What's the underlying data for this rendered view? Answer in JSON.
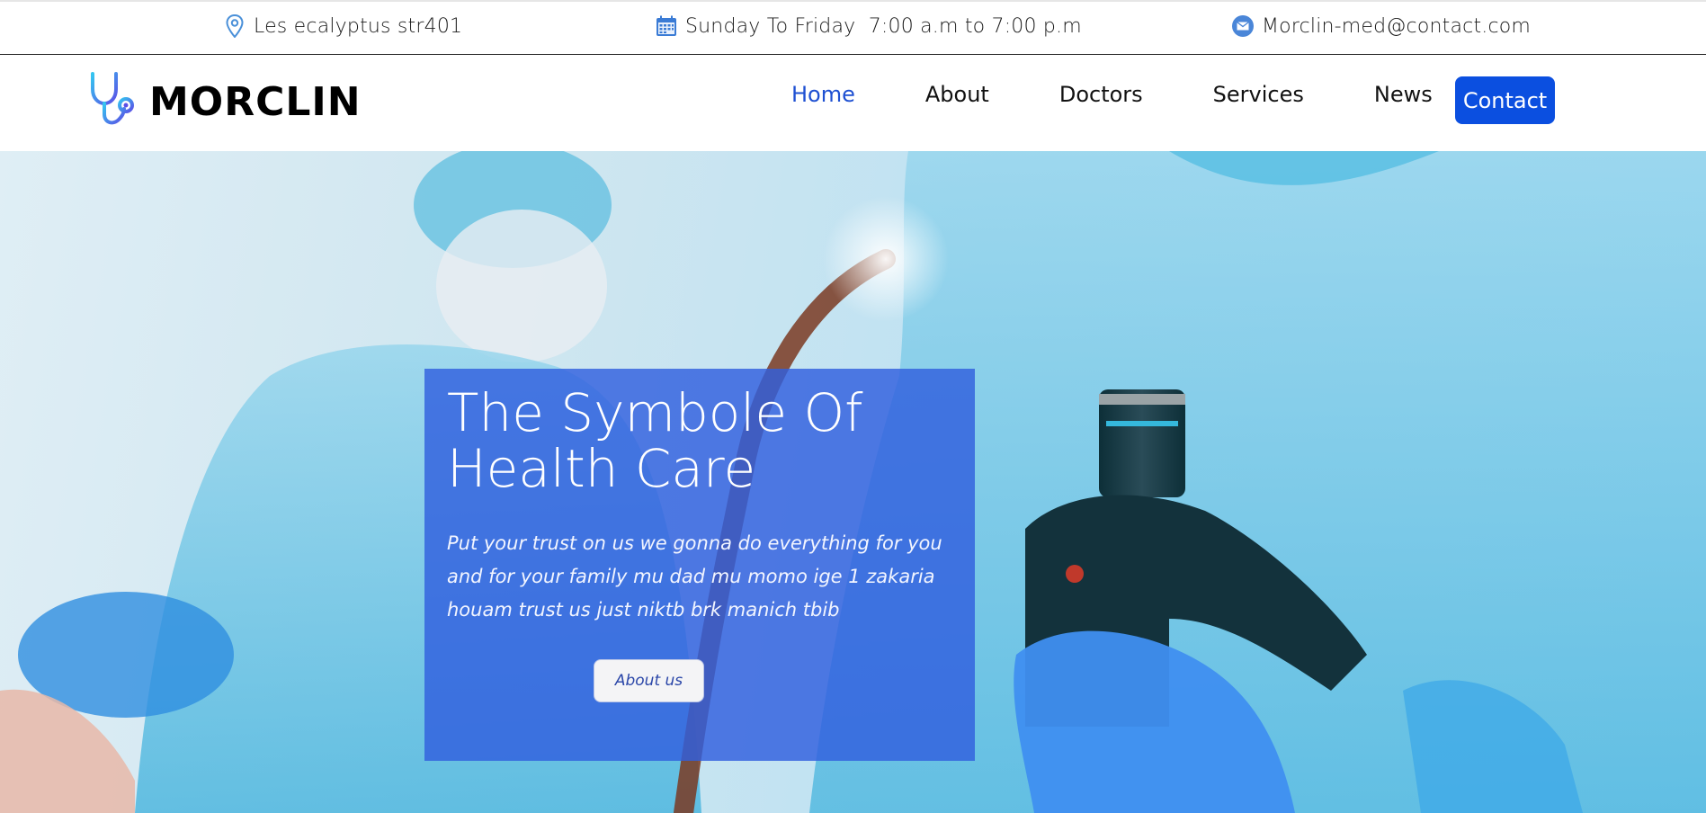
{
  "topbar": {
    "address": "Les ecalyptus str401",
    "hours": "Sunday To Friday  7:00 a.m to 7:00 p.m",
    "email": "Morclin-med@contact.com",
    "icons": [
      "location-pin-icon",
      "calendar-icon",
      "mail-icon"
    ]
  },
  "brand": {
    "name": "MORCLIN",
    "logo_icon": "stethoscope-icon"
  },
  "nav": {
    "items": [
      {
        "label": "Home",
        "active": true
      },
      {
        "label": "About",
        "active": false
      },
      {
        "label": "Doctors",
        "active": false
      },
      {
        "label": "Services",
        "active": false
      },
      {
        "label": "News",
        "active": false
      }
    ],
    "contact_label": "Contact"
  },
  "hero": {
    "title_line1": "The Symbole Of",
    "title_line2": "Health Care",
    "text_line1": "Put your trust on us we gonna do everything for you",
    "text_line2": "and for your family mu dad mu momo ige 1 zakaria",
    "text_line3": "houam trust us just niktb brk manich tbib",
    "button_label": "About us"
  },
  "colors": {
    "accent": "#0b4fe0",
    "active_link": "#1e50d2",
    "panel": "#315fde"
  }
}
